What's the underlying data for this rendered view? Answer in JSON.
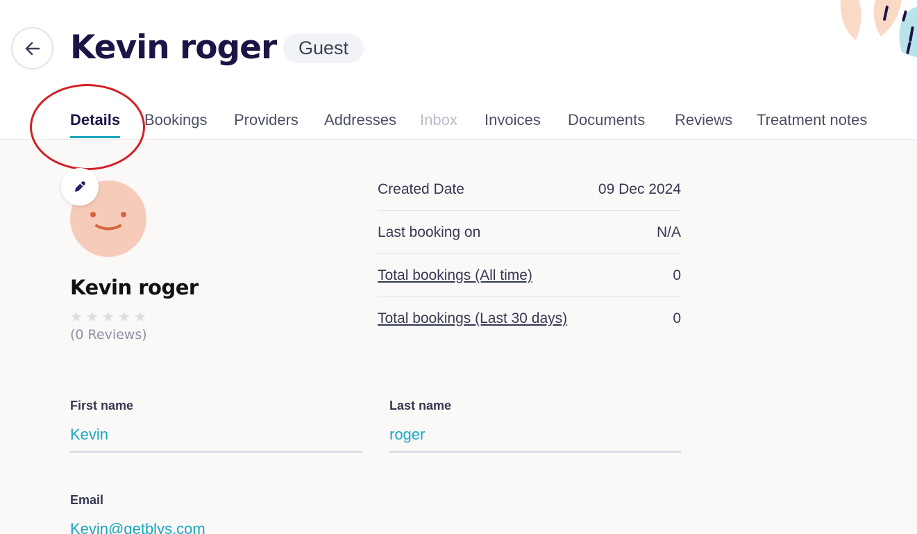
{
  "header": {
    "title": "Kevin roger",
    "role_badge": "Guest",
    "back_icon": "arrow-left-icon"
  },
  "tabs": [
    {
      "label": "Details",
      "state": "active"
    },
    {
      "label": "Bookings",
      "state": "normal"
    },
    {
      "label": "Providers",
      "state": "normal"
    },
    {
      "label": "Addresses",
      "state": "normal"
    },
    {
      "label": "Inbox",
      "state": "disabled"
    },
    {
      "label": "Invoices",
      "state": "normal"
    },
    {
      "label": "Documents",
      "state": "normal"
    },
    {
      "label": "Reviews",
      "state": "normal"
    },
    {
      "label": "Treatment notes",
      "state": "normal"
    }
  ],
  "profile": {
    "name": "Kevin roger",
    "rating": 0,
    "reviews_label": "(0 Reviews)",
    "edit_icon": "pencil-icon"
  },
  "stats": [
    {
      "label": "Created Date",
      "value": "09 Dec 2024",
      "link": false
    },
    {
      "label": "Last booking on",
      "value": "N/A",
      "link": false
    },
    {
      "label": "Total bookings (All time)",
      "value": "0",
      "link": true
    },
    {
      "label": "Total bookings (Last 30 days)",
      "value": "0",
      "link": true
    }
  ],
  "form": {
    "first_name": {
      "label": "First name",
      "value": "Kevin"
    },
    "last_name": {
      "label": "Last name",
      "value": "roger"
    },
    "email": {
      "label": "Email",
      "value": "Kevin@getblys.com"
    }
  },
  "colors": {
    "accent": "#1aa7bd",
    "title": "#1b1547",
    "annotation": "#d51f26",
    "avatar": "#f7cbb9"
  }
}
